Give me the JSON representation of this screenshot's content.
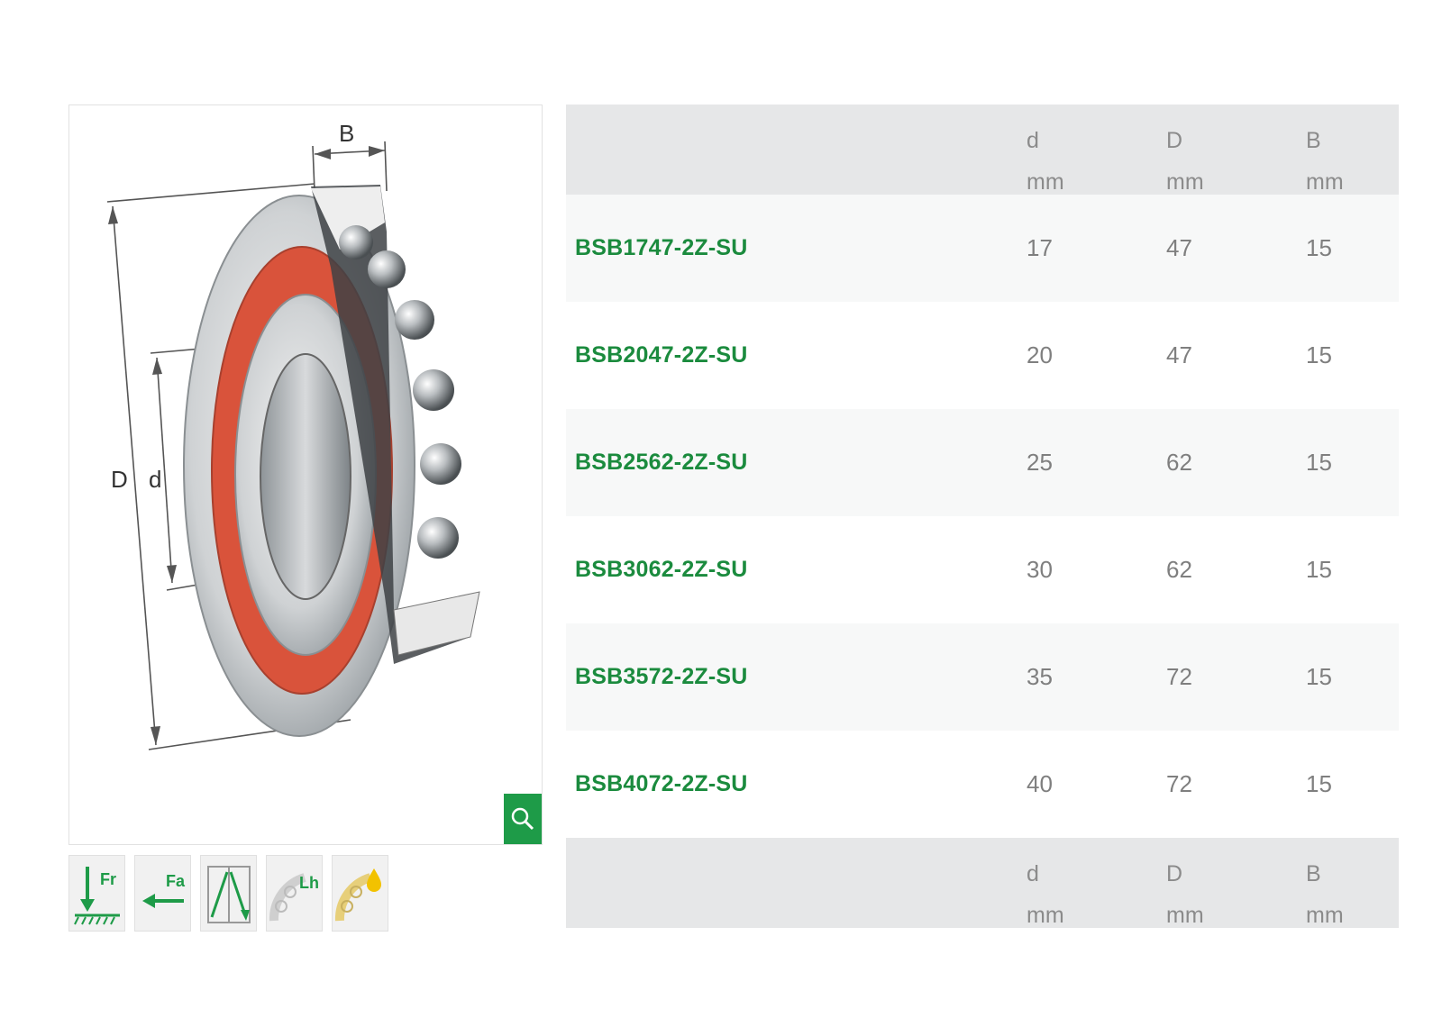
{
  "drawing": {
    "label_B": "B",
    "label_D": "D",
    "label_d": "d"
  },
  "columns": [
    {
      "symbol": "d",
      "unit": "mm"
    },
    {
      "symbol": "D",
      "unit": "mm"
    },
    {
      "symbol": "B",
      "unit": "mm"
    }
  ],
  "rows": [
    {
      "designation": "BSB1747-2Z-SU",
      "d": "17",
      "D": "47",
      "B": "15"
    },
    {
      "designation": "BSB2047-2Z-SU",
      "d": "20",
      "D": "47",
      "B": "15"
    },
    {
      "designation": "BSB2562-2Z-SU",
      "d": "25",
      "D": "62",
      "B": "15"
    },
    {
      "designation": "BSB3062-2Z-SU",
      "d": "30",
      "D": "62",
      "B": "15"
    },
    {
      "designation": "BSB3572-2Z-SU",
      "d": "35",
      "D": "72",
      "B": "15"
    },
    {
      "designation": "BSB4072-2Z-SU",
      "d": "40",
      "D": "72",
      "B": "15"
    }
  ],
  "thumbnails": [
    {
      "icon": "radial-load-icon",
      "label": "Fr"
    },
    {
      "icon": "axial-load-icon",
      "label": "Fa"
    },
    {
      "icon": "angular-contact-icon",
      "label": ""
    },
    {
      "icon": "rating-life-icon",
      "label": "Lh"
    },
    {
      "icon": "lubrication-icon",
      "label": ""
    }
  ],
  "colors": {
    "accent_green": "#1e9b48",
    "link_green": "#1b8b3e",
    "seal_red": "#d9533b",
    "header_grey": "#e6e7e8"
  }
}
